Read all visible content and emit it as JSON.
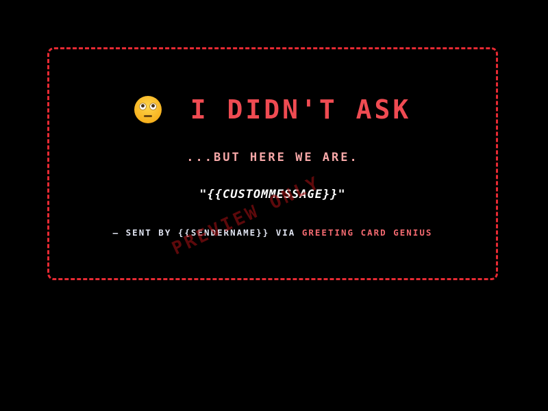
{
  "card": {
    "icon": "face-with-rolling-eyes-icon",
    "title": "I DIDN'T ASK",
    "subtitle": "...BUT HERE WE ARE.",
    "message": "\"{{CUSTOMMESSAGE}}\"",
    "footer": {
      "prefix": "— SENT BY {{SENDERNAME}} VIA",
      "brand": "GREETING CARD GENIUS"
    },
    "watermark": "PREVIEW ONLY"
  },
  "colors": {
    "background": "#000000",
    "border": "#e82a33",
    "title": "#ef4b52",
    "subtitle": "#f7a8a8",
    "accent": "#f36a70",
    "text": "#ffffff"
  }
}
